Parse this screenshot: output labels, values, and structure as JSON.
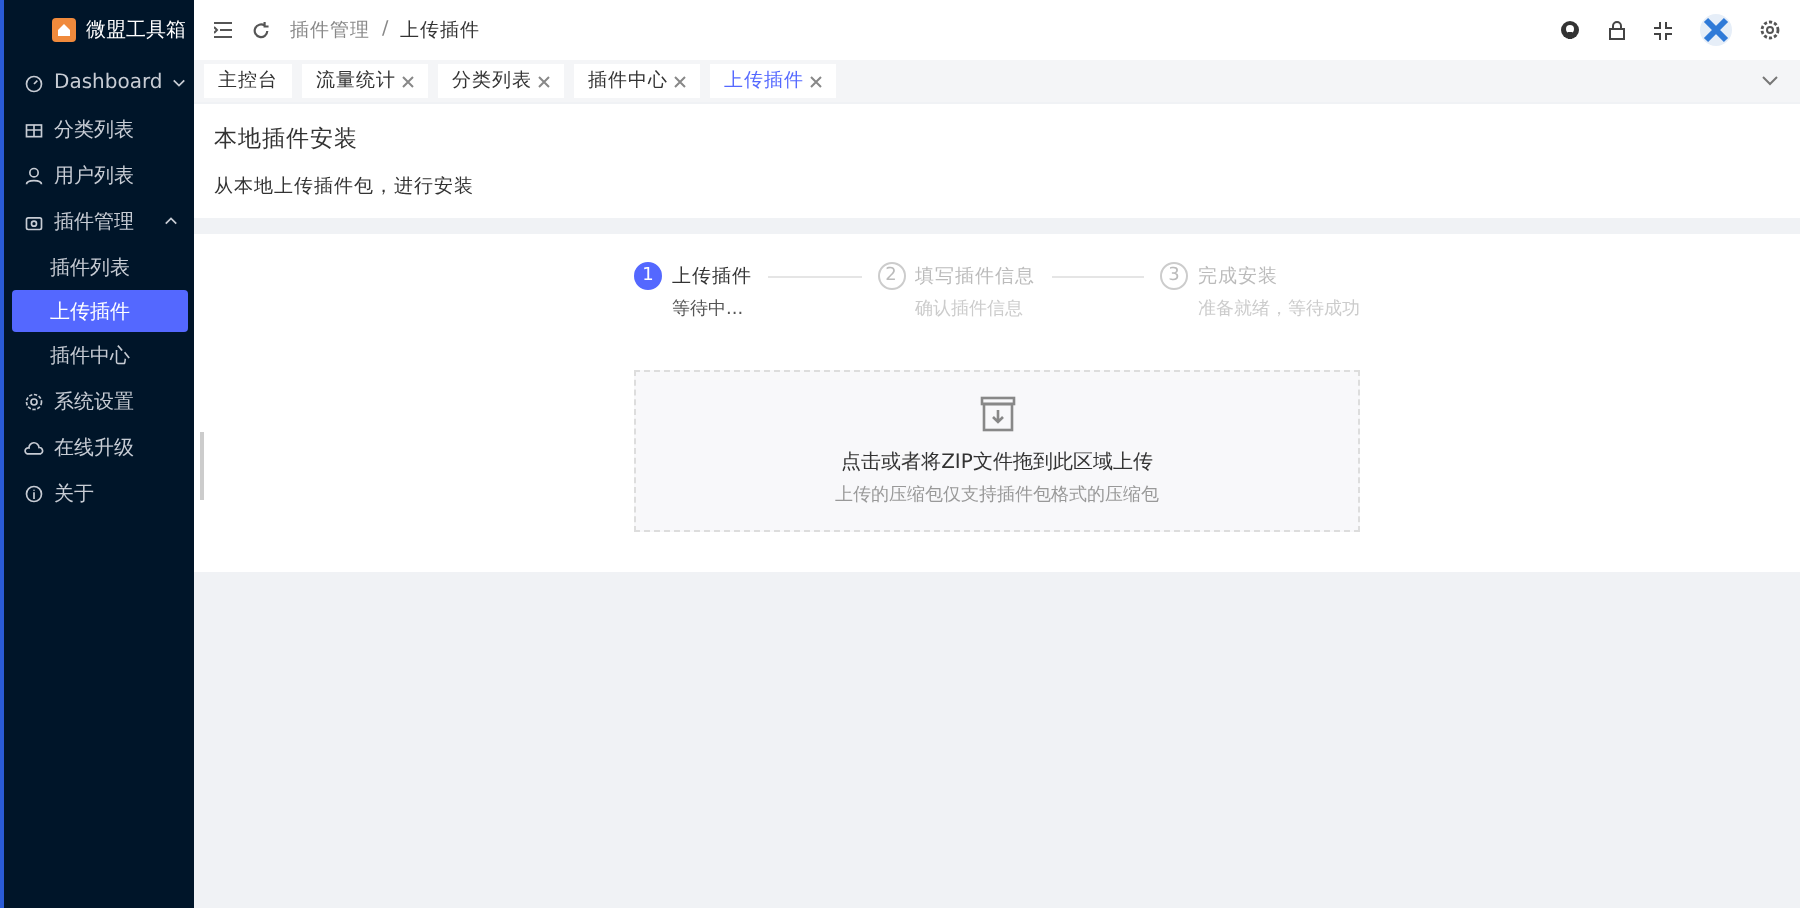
{
  "sidebar": {
    "logo": "微盟工具箱",
    "items": [
      {
        "label": "Dashboard",
        "expanded": false,
        "selected": false
      },
      {
        "label": "分类列表",
        "selected": false
      },
      {
        "label": "用户列表",
        "selected": false
      },
      {
        "label": "插件管理",
        "expanded": true,
        "selected": false,
        "children": [
          {
            "label": "插件列表",
            "selected": false
          },
          {
            "label": "上传插件",
            "selected": true
          },
          {
            "label": "插件中心",
            "selected": false
          }
        ]
      },
      {
        "label": "系统设置",
        "selected": false
      },
      {
        "label": "在线升级",
        "selected": false
      },
      {
        "label": "关于",
        "selected": false
      }
    ]
  },
  "header": {
    "breadcrumb": [
      "插件管理",
      "上传插件"
    ],
    "separator": "/"
  },
  "tabs": [
    {
      "label": "主控台",
      "closable": false,
      "selected": false
    },
    {
      "label": "流量统计",
      "closable": true,
      "selected": false
    },
    {
      "label": "分类列表",
      "closable": true,
      "selected": false
    },
    {
      "label": "插件中心",
      "closable": true,
      "selected": false
    },
    {
      "label": "上传插件",
      "closable": true,
      "selected": true
    }
  ],
  "page": {
    "title": "本地插件安装",
    "subtitle": "从本地上传插件包，进行安装"
  },
  "steps": [
    {
      "number": "1",
      "title": "上传插件",
      "description": "等待中...",
      "selected": true
    },
    {
      "number": "2",
      "title": "填写插件信息",
      "description": "确认插件信息",
      "selected": false
    },
    {
      "number": "3",
      "title": "完成安装",
      "description": "准备就绪，等待成功",
      "selected": false
    }
  ],
  "upload": {
    "text": "点击或者将ZIP文件拖到此区域上传",
    "hint": "上传的压缩包仅支持插件包格式的压缩包"
  }
}
